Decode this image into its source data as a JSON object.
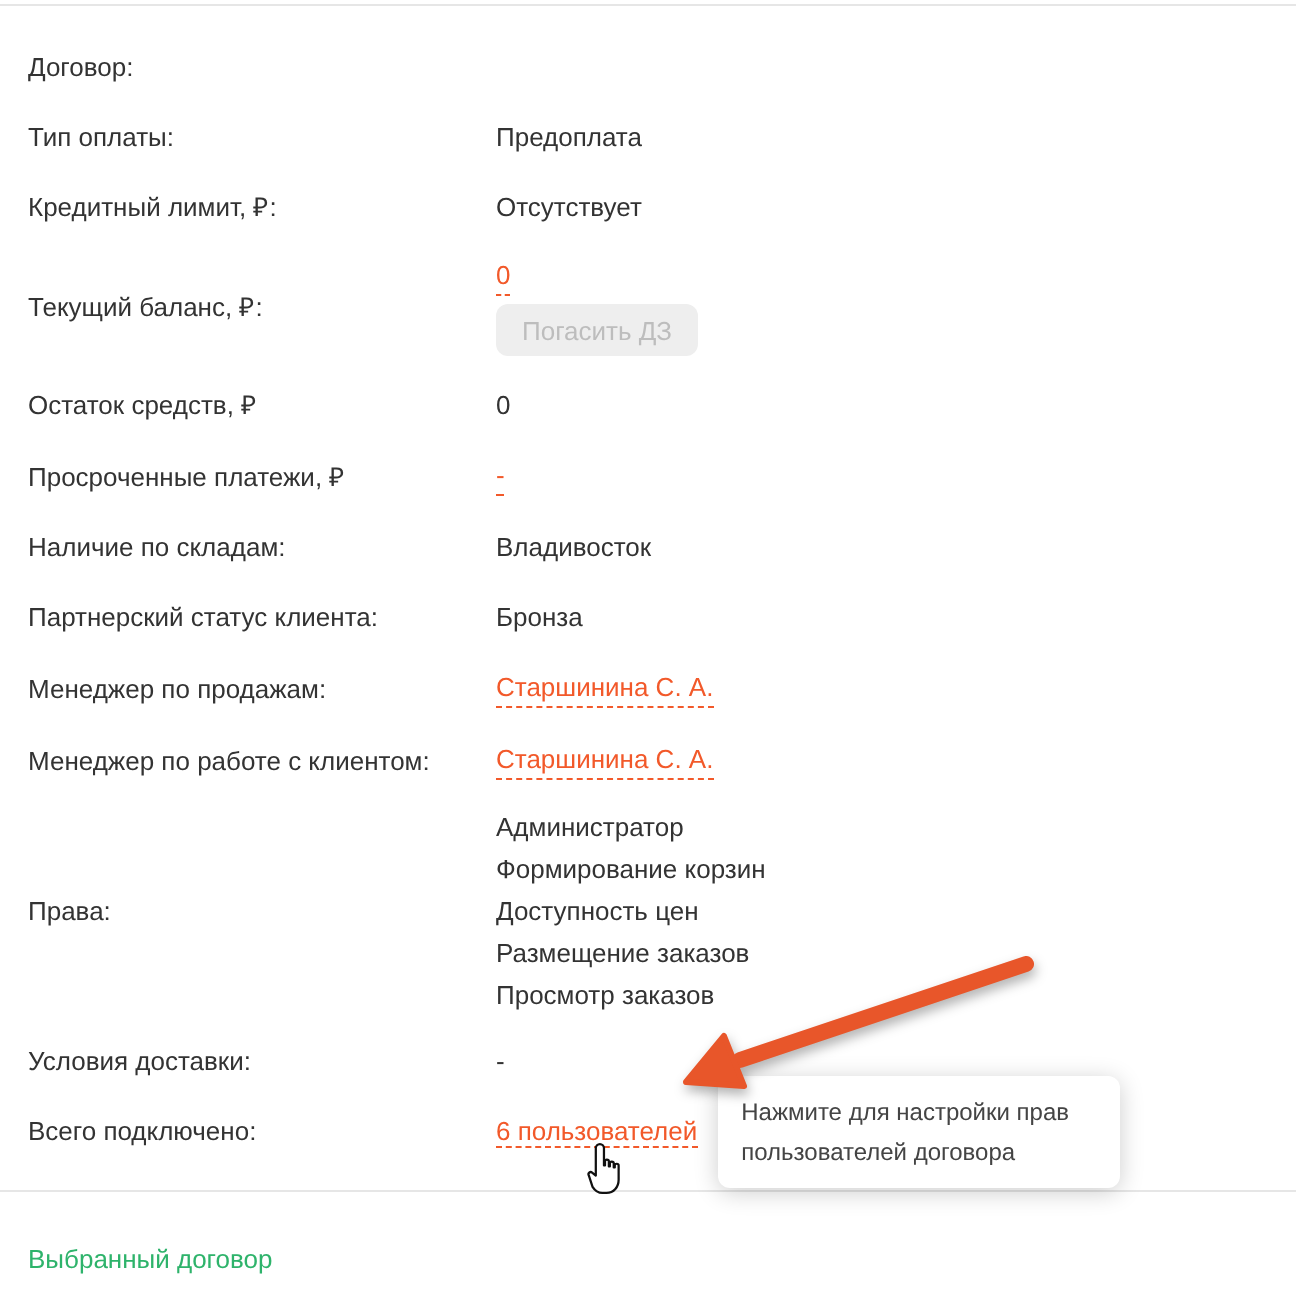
{
  "rows": [
    {
      "label": "Договор:"
    },
    {
      "label": "Тип оплаты:",
      "value": {
        "kind": "text",
        "text": "Предоплата"
      }
    },
    {
      "label": "Кредитный лимит, ₽:",
      "value": {
        "kind": "text",
        "text": "Отсутствует"
      }
    },
    {
      "label": "Текущий баланс, ₽:",
      "value": {
        "kind": "link",
        "text": "0"
      },
      "button": {
        "label": "Погасить ДЗ",
        "disabled": true
      }
    },
    {
      "label": "Остаток средств, ₽",
      "value": {
        "kind": "text",
        "text": "0"
      }
    },
    {
      "label": "Просроченные платежи, ₽",
      "value": {
        "kind": "link",
        "text": "-"
      }
    },
    {
      "label": "Наличие по складам:",
      "value": {
        "kind": "text",
        "text": "Владивосток"
      }
    },
    {
      "label": "Партнерский статус клиента:",
      "value": {
        "kind": "text",
        "text": "Бронза"
      }
    },
    {
      "label": "Менеджер по продажам:",
      "value": {
        "kind": "link",
        "text": "Старшинина С. А."
      }
    },
    {
      "label": "Менеджер по работе с клиентом:",
      "value": {
        "kind": "link",
        "text": "Старшинина С. А."
      }
    },
    {
      "label": "Права:",
      "value": {
        "kind": "list",
        "items": [
          "Администратор",
          "Формирование корзин",
          "Доступность цен",
          "Размещение заказов",
          "Просмотр заказов"
        ]
      }
    },
    {
      "label": "Условия доставки:",
      "value": {
        "kind": "text",
        "text": "-"
      }
    },
    {
      "label": "Всего подключено:",
      "value": {
        "kind": "link",
        "text": "6 пользователей"
      },
      "tooltip": "Нажмите для настройки прав пользователей договора"
    }
  ],
  "footer": {
    "link": "Выбранный договор"
  }
}
